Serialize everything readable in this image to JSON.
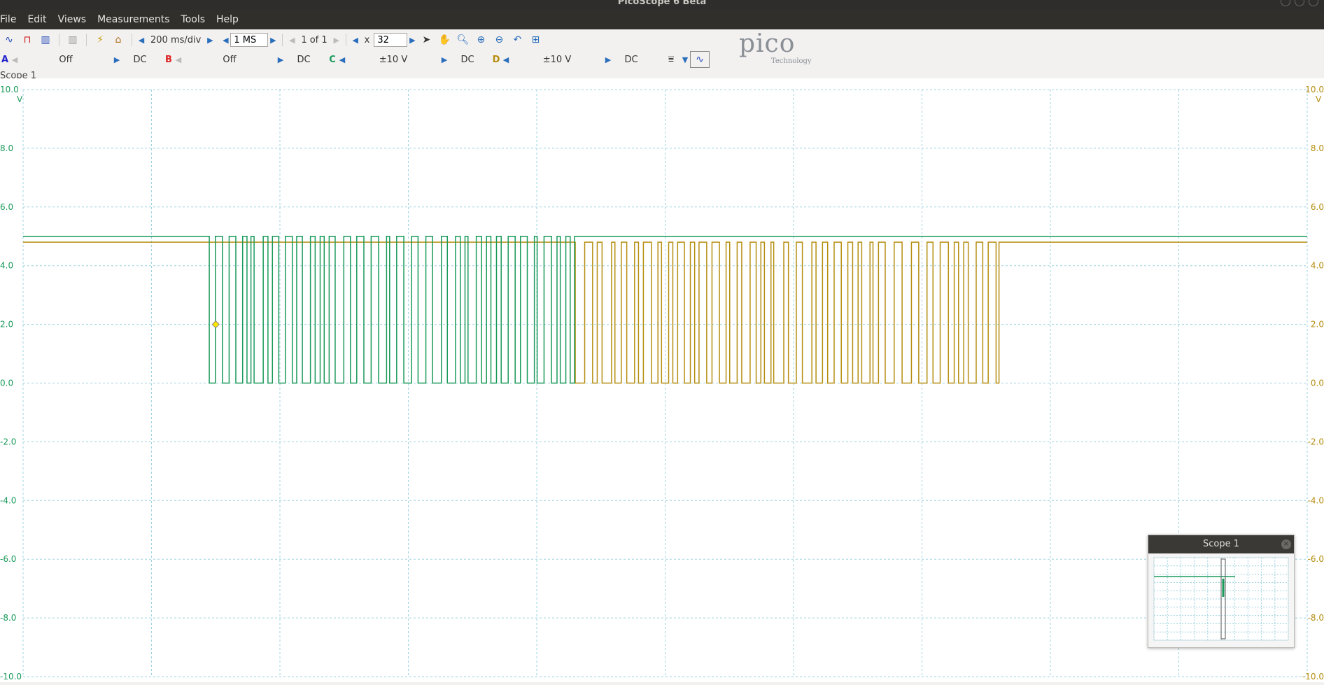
{
  "window": {
    "title": "PicoScope 6 Beta"
  },
  "menu": [
    "File",
    "Edit",
    "Views",
    "Measurements",
    "Tools",
    "Help"
  ],
  "toolbar": {
    "timebase": "200 ms/div",
    "samples": "1 MS",
    "capture": "1 of 1",
    "zoom_prefix": "x",
    "zoom": "32"
  },
  "channels": [
    {
      "label": "A",
      "range": "Off",
      "coupling": "DC",
      "color": "#2222cc"
    },
    {
      "label": "B",
      "range": "Off",
      "coupling": "DC",
      "color": "#dd2222"
    },
    {
      "label": "C",
      "range": "±10 V",
      "coupling": "DC",
      "color": "#1a9a5a"
    },
    {
      "label": "D",
      "range": "±10 V",
      "coupling": "DC",
      "color": "#b58e10"
    }
  ],
  "logo": {
    "text": "pico",
    "sub": "Technology"
  },
  "scope": {
    "label": "Scope 1",
    "mini_title": "Scope 1"
  },
  "axis": {
    "left_labels": [
      "10.0",
      "8.0",
      "6.0",
      "4.0",
      "2.0",
      "0.0",
      "-2.0",
      "-4.0",
      "-6.0",
      "-8.0",
      "-10.0"
    ],
    "right_labels": [
      "10.0",
      "8.0",
      "6.0",
      "4.0",
      "2.0",
      "0.0",
      "-2.0",
      "-4.0",
      "-6.0",
      "-8.0",
      "-10.0"
    ],
    "unit": "V",
    "ylim": [
      -10,
      10
    ],
    "grid_divisions_x": 10
  },
  "chart_data": {
    "type": "line",
    "series": [
      {
        "name": "C",
        "color": "#1a9a5a",
        "x": [
          0.0,
          1.45,
          1.45,
          4.3,
          4.3,
          10.0
        ],
        "y": [
          5.0,
          5.0,
          "toggling 0..5",
          "toggling 0..5",
          5.0,
          5.0
        ]
      },
      {
        "name": "D",
        "color": "#b58e10",
        "x": [
          0.0,
          4.3,
          4.3,
          7.6,
          7.6,
          10.0
        ],
        "y": [
          4.8,
          4.8,
          "toggling 0..4.8",
          "toggling 0..4.8",
          4.8,
          4.8
        ]
      }
    ],
    "ylim": [
      -10,
      10
    ],
    "trigger": {
      "x": 1.5,
      "y": 2.0
    }
  },
  "colors": {
    "channel_c": "#1a9a5a",
    "channel_d": "#b58e10",
    "grid": "#9fd3e0",
    "plot_bg": "#ffffff"
  }
}
